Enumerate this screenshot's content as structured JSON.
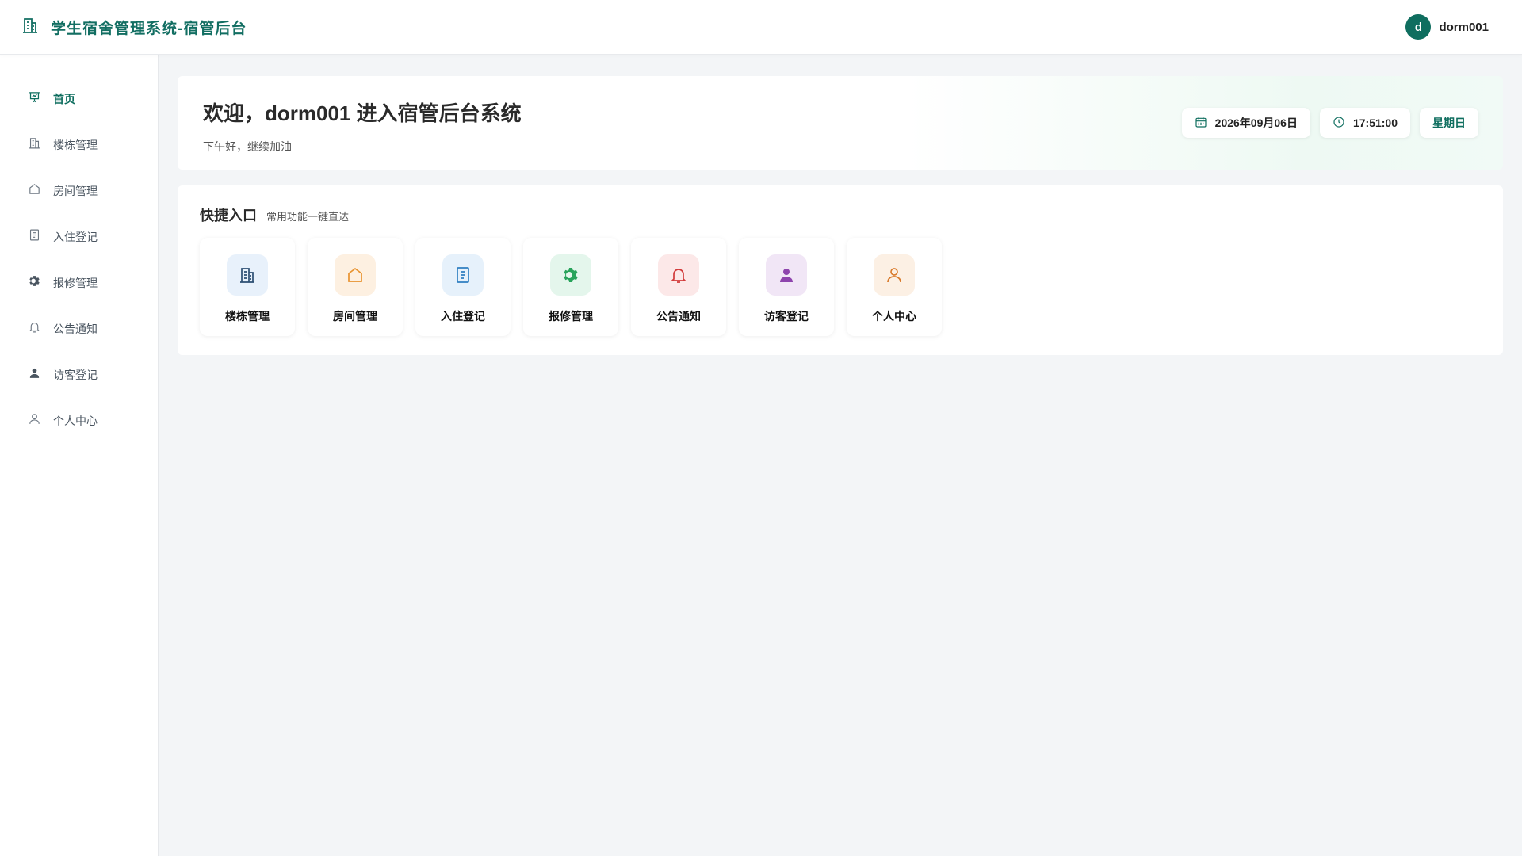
{
  "header": {
    "title": "学生宿舍管理系统-宿管后台",
    "user": {
      "avatar_letter": "d",
      "name": "dorm001"
    }
  },
  "sidebar": {
    "items": [
      {
        "label": "首页",
        "icon": "home-chart-icon",
        "active": true
      },
      {
        "label": "楼栋管理",
        "icon": "building-icon"
      },
      {
        "label": "房间管理",
        "icon": "house-icon"
      },
      {
        "label": "入住登记",
        "icon": "document-icon"
      },
      {
        "label": "报修管理",
        "icon": "gear-icon"
      },
      {
        "label": "公告通知",
        "icon": "bell-icon"
      },
      {
        "label": "访客登记",
        "icon": "user-filled-icon"
      },
      {
        "label": "个人中心",
        "icon": "user-outline-icon"
      }
    ]
  },
  "welcome": {
    "title": "欢迎，dorm001 进入宿管后台系统",
    "subtitle": "下午好，继续加油",
    "date": "2026年09月06日",
    "time": "17:51:00",
    "weekday": "星期日"
  },
  "quick": {
    "title": "快捷入口",
    "subtitle": "常用功能一键直达",
    "cards": [
      {
        "label": "楼栋管理",
        "icon": "building-icon",
        "color": "#2d4f73",
        "bg": "#e8f1fb"
      },
      {
        "label": "房间管理",
        "icon": "house-icon",
        "color": "#e8932f",
        "bg": "#fdf0e1"
      },
      {
        "label": "入住登记",
        "icon": "document-icon",
        "color": "#2f7fc1",
        "bg": "#e6f1fb"
      },
      {
        "label": "报修管理",
        "icon": "gear-icon",
        "color": "#27a35a",
        "bg": "#e4f6ec"
      },
      {
        "label": "公告通知",
        "icon": "bell-icon",
        "color": "#d23b3b",
        "bg": "#fce8e8"
      },
      {
        "label": "访客登记",
        "icon": "user-filled-icon",
        "color": "#8e44ad",
        "bg": "#f1e6f6"
      },
      {
        "label": "个人中心",
        "icon": "user-outline-icon",
        "color": "#d97a2b",
        "bg": "#fcf0e4"
      }
    ]
  },
  "colors": {
    "brand": "#0f6e5f",
    "background": "#f3f5f7"
  }
}
